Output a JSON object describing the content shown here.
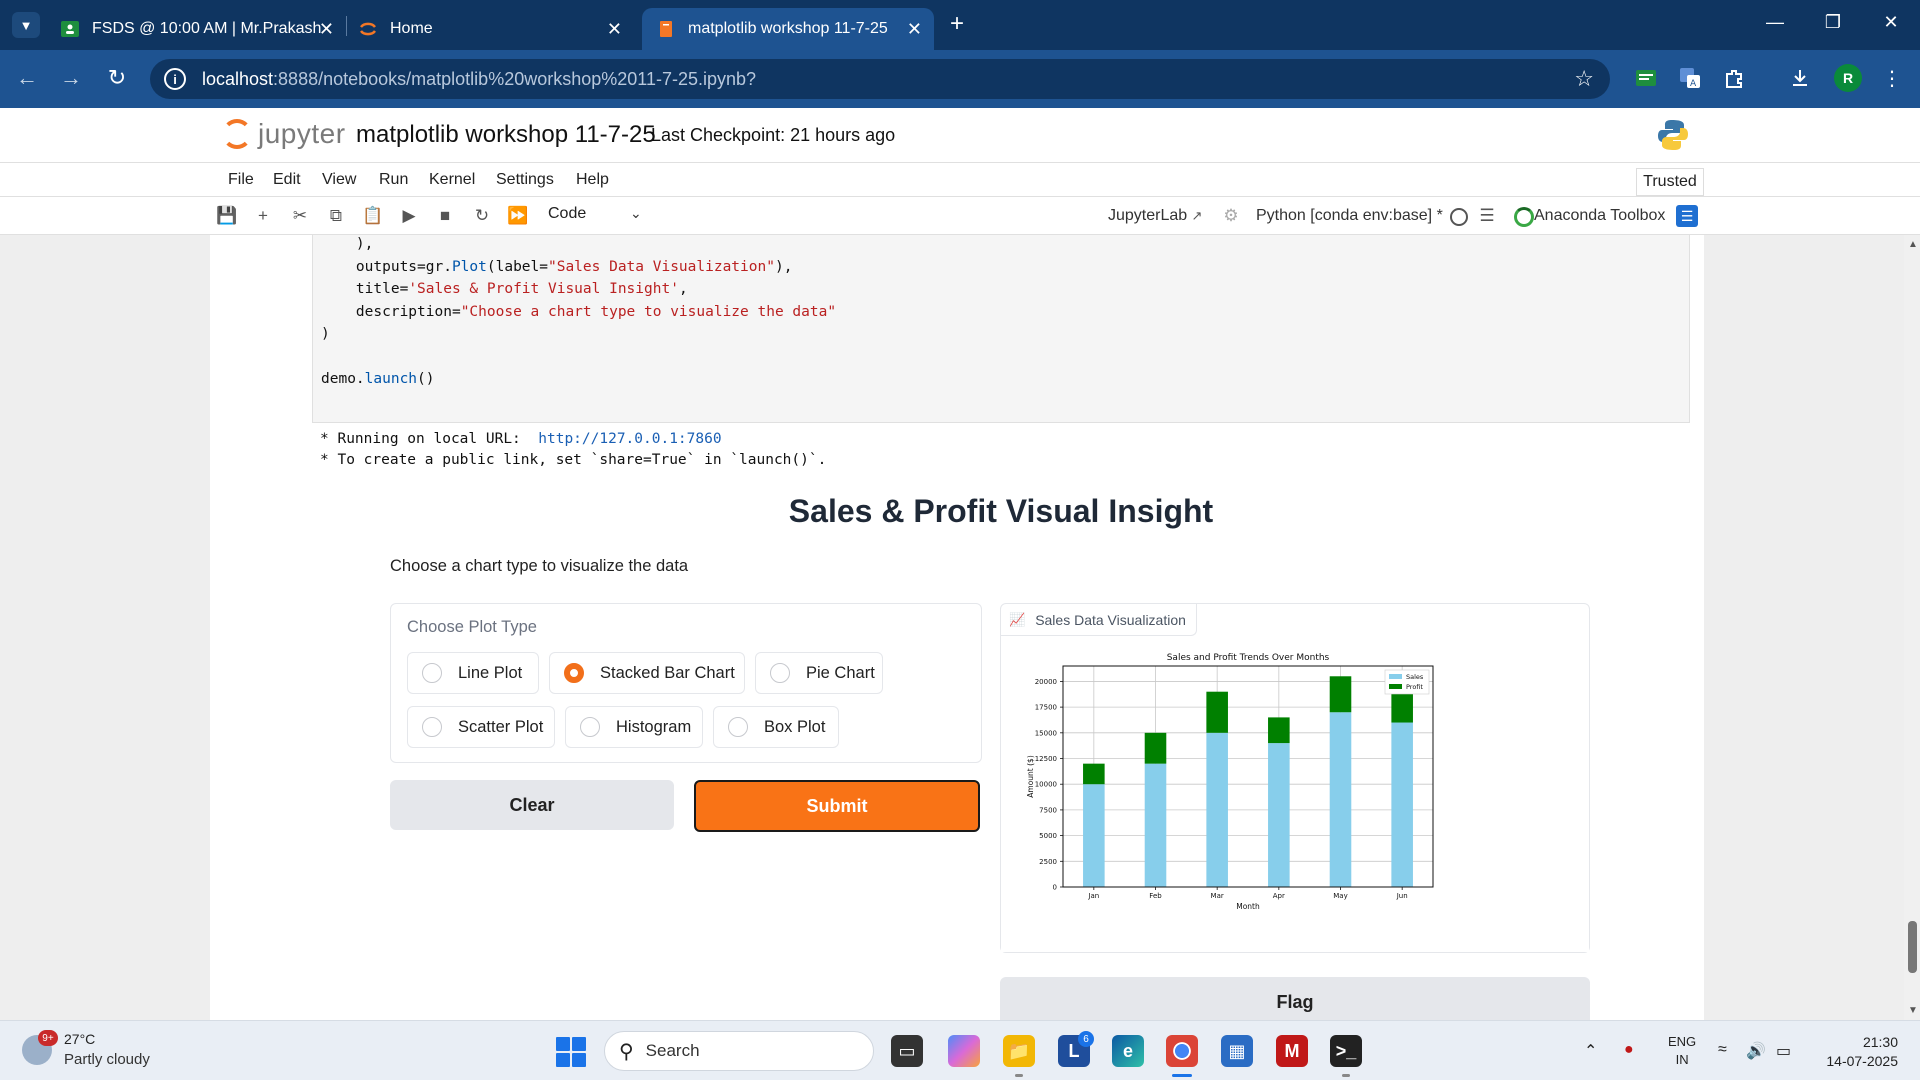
{
  "browser": {
    "tabs": [
      {
        "label": "FSDS @ 10:00 AM | Mr.Prakash",
        "icon": "classroom-icon"
      },
      {
        "label": "Home",
        "icon": "jupyter-icon"
      },
      {
        "label": "matplotlib workshop 11-7-25",
        "icon": "notebook-icon",
        "active": true
      }
    ],
    "url_host": "localhost",
    "url_path": ":8888/notebooks/matplotlib%20workshop%2011-7-25.ipynb?",
    "profile_initial": "R"
  },
  "jupyter": {
    "logo_text": "jupyter",
    "notebook_title": "matplotlib workshop 11-7-25",
    "checkpoint": "Last Checkpoint: 21 hours ago",
    "menu": [
      "File",
      "Edit",
      "View",
      "Run",
      "Kernel",
      "Settings",
      "Help"
    ],
    "trusted": "Trusted",
    "cell_type": "Code",
    "jupyterlab_label": "JupyterLab",
    "kernel_label": "Python [conda env:base] *",
    "anaconda_label": "Anaconda Toolbox"
  },
  "code_lines": {
    "l1": "    ),",
    "l2a": "    outputs=gr.",
    "l2b": "Plot",
    "l2c": "(label=",
    "l2d": "\"Sales Data Visualization\"",
    "l2e": "),",
    "l3a": "    title=",
    "l3b": "'Sales & Profit Visual Insight'",
    "l3c": ",",
    "l4a": "    description=",
    "l4b": "\"Choose a chart type to visualize the data\"",
    "l5": ")",
    "l6a": "demo.",
    "l6b": "launch",
    "l6c": "()"
  },
  "output": {
    "line1_prefix": "* Running on local URL:  ",
    "line1_url": "http://127.0.0.1:7860",
    "line2": "* To create a public link, set `share=True` in `launch()`."
  },
  "gradio": {
    "title": "Sales & Profit Visual Insight",
    "description": "Choose a chart type to visualize the data",
    "radio_label": "Choose Plot Type",
    "options": [
      "Line Plot",
      "Stacked Bar Chart",
      "Pie Chart",
      "Scatter Plot",
      "Histogram",
      "Box Plot"
    ],
    "selected": "Stacked Bar Chart",
    "clear_label": "Clear",
    "submit_label": "Submit",
    "plot_label": "Sales Data Visualization",
    "flag_label": "Flag",
    "accent_color": "#f97316"
  },
  "chart_data": {
    "type": "bar",
    "stacked": true,
    "title": "Sales and Profit Trends Over Months",
    "xlabel": "Month",
    "ylabel": "Amount ($)",
    "categories": [
      "Jan",
      "Feb",
      "Mar",
      "Apr",
      "May",
      "Jun"
    ],
    "series": [
      {
        "name": "Sales",
        "values": [
          10000,
          12000,
          15000,
          14000,
          17000,
          16000
        ],
        "color": "#87ceeb"
      },
      {
        "name": "Profit",
        "values": [
          2000,
          3000,
          4000,
          2500,
          3500,
          3000
        ],
        "color": "#008000"
      }
    ],
    "yticks": [
      0,
      2500,
      5000,
      7500,
      10000,
      12500,
      15000,
      17500,
      20000
    ],
    "ylim": [
      0,
      21500
    ],
    "grid": true,
    "legend": "top-right"
  },
  "taskbar": {
    "weather_temp": "27°C",
    "weather_desc": "Partly cloudy",
    "weather_badge": "9+",
    "search_label": "Search",
    "lang1": "ENG",
    "lang2": "IN",
    "time": "21:30",
    "date": "14-07-2025",
    "mail_badge": "6"
  }
}
